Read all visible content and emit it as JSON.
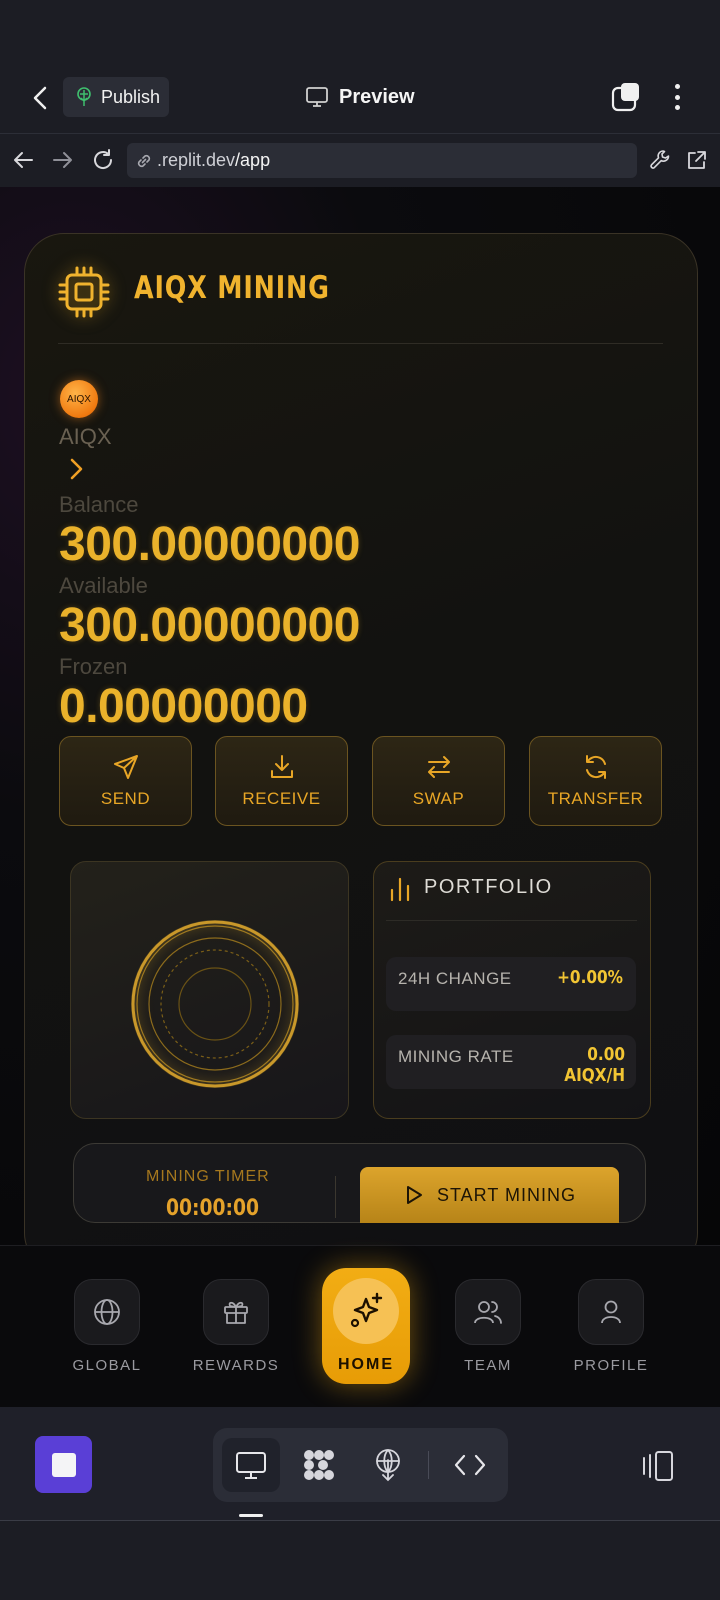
{
  "header": {
    "publish_label": "Publish",
    "preview_label": "Preview"
  },
  "urlbar": {
    "domain": ".replit.dev",
    "path": "/app"
  },
  "app": {
    "title": "AIQX MINING",
    "token": {
      "logo_text": "AIQX",
      "name": "AIQX"
    },
    "balance_label": "Balance",
    "balance_value": "300.00000000",
    "available_label": "Available",
    "available_value": "300.00000000",
    "frozen_label": "Frozen",
    "frozen_value": "0.00000000",
    "actions": [
      {
        "label": "SEND",
        "icon": "send-icon"
      },
      {
        "label": "RECEIVE",
        "icon": "download-icon"
      },
      {
        "label": "SWAP",
        "icon": "swap-icon"
      },
      {
        "label": "TRANSFER",
        "icon": "refresh-icon"
      }
    ],
    "portfolio": {
      "title": "PORTFOLIO",
      "change_label": "24H CHANGE",
      "change_value": "+0.00%",
      "rate_label": "MINING RATE",
      "rate_value": "0.00 AIQX/H"
    },
    "timer": {
      "label": "MINING TIMER",
      "value": "00:00:00",
      "start_label": "START MINING"
    },
    "nav": [
      {
        "label": "GLOBAL",
        "icon": "globe-icon"
      },
      {
        "label": "REWARDS",
        "icon": "gift-icon"
      },
      {
        "label": "HOME",
        "icon": "sparkle-icon",
        "active": true
      },
      {
        "label": "TEAM",
        "icon": "users-icon"
      },
      {
        "label": "PROFILE",
        "icon": "user-icon"
      }
    ]
  },
  "colors": {
    "accent_gold": "#eab22b",
    "home_orange": "#f2ad14",
    "stop_purple": "#5a3fd6"
  }
}
